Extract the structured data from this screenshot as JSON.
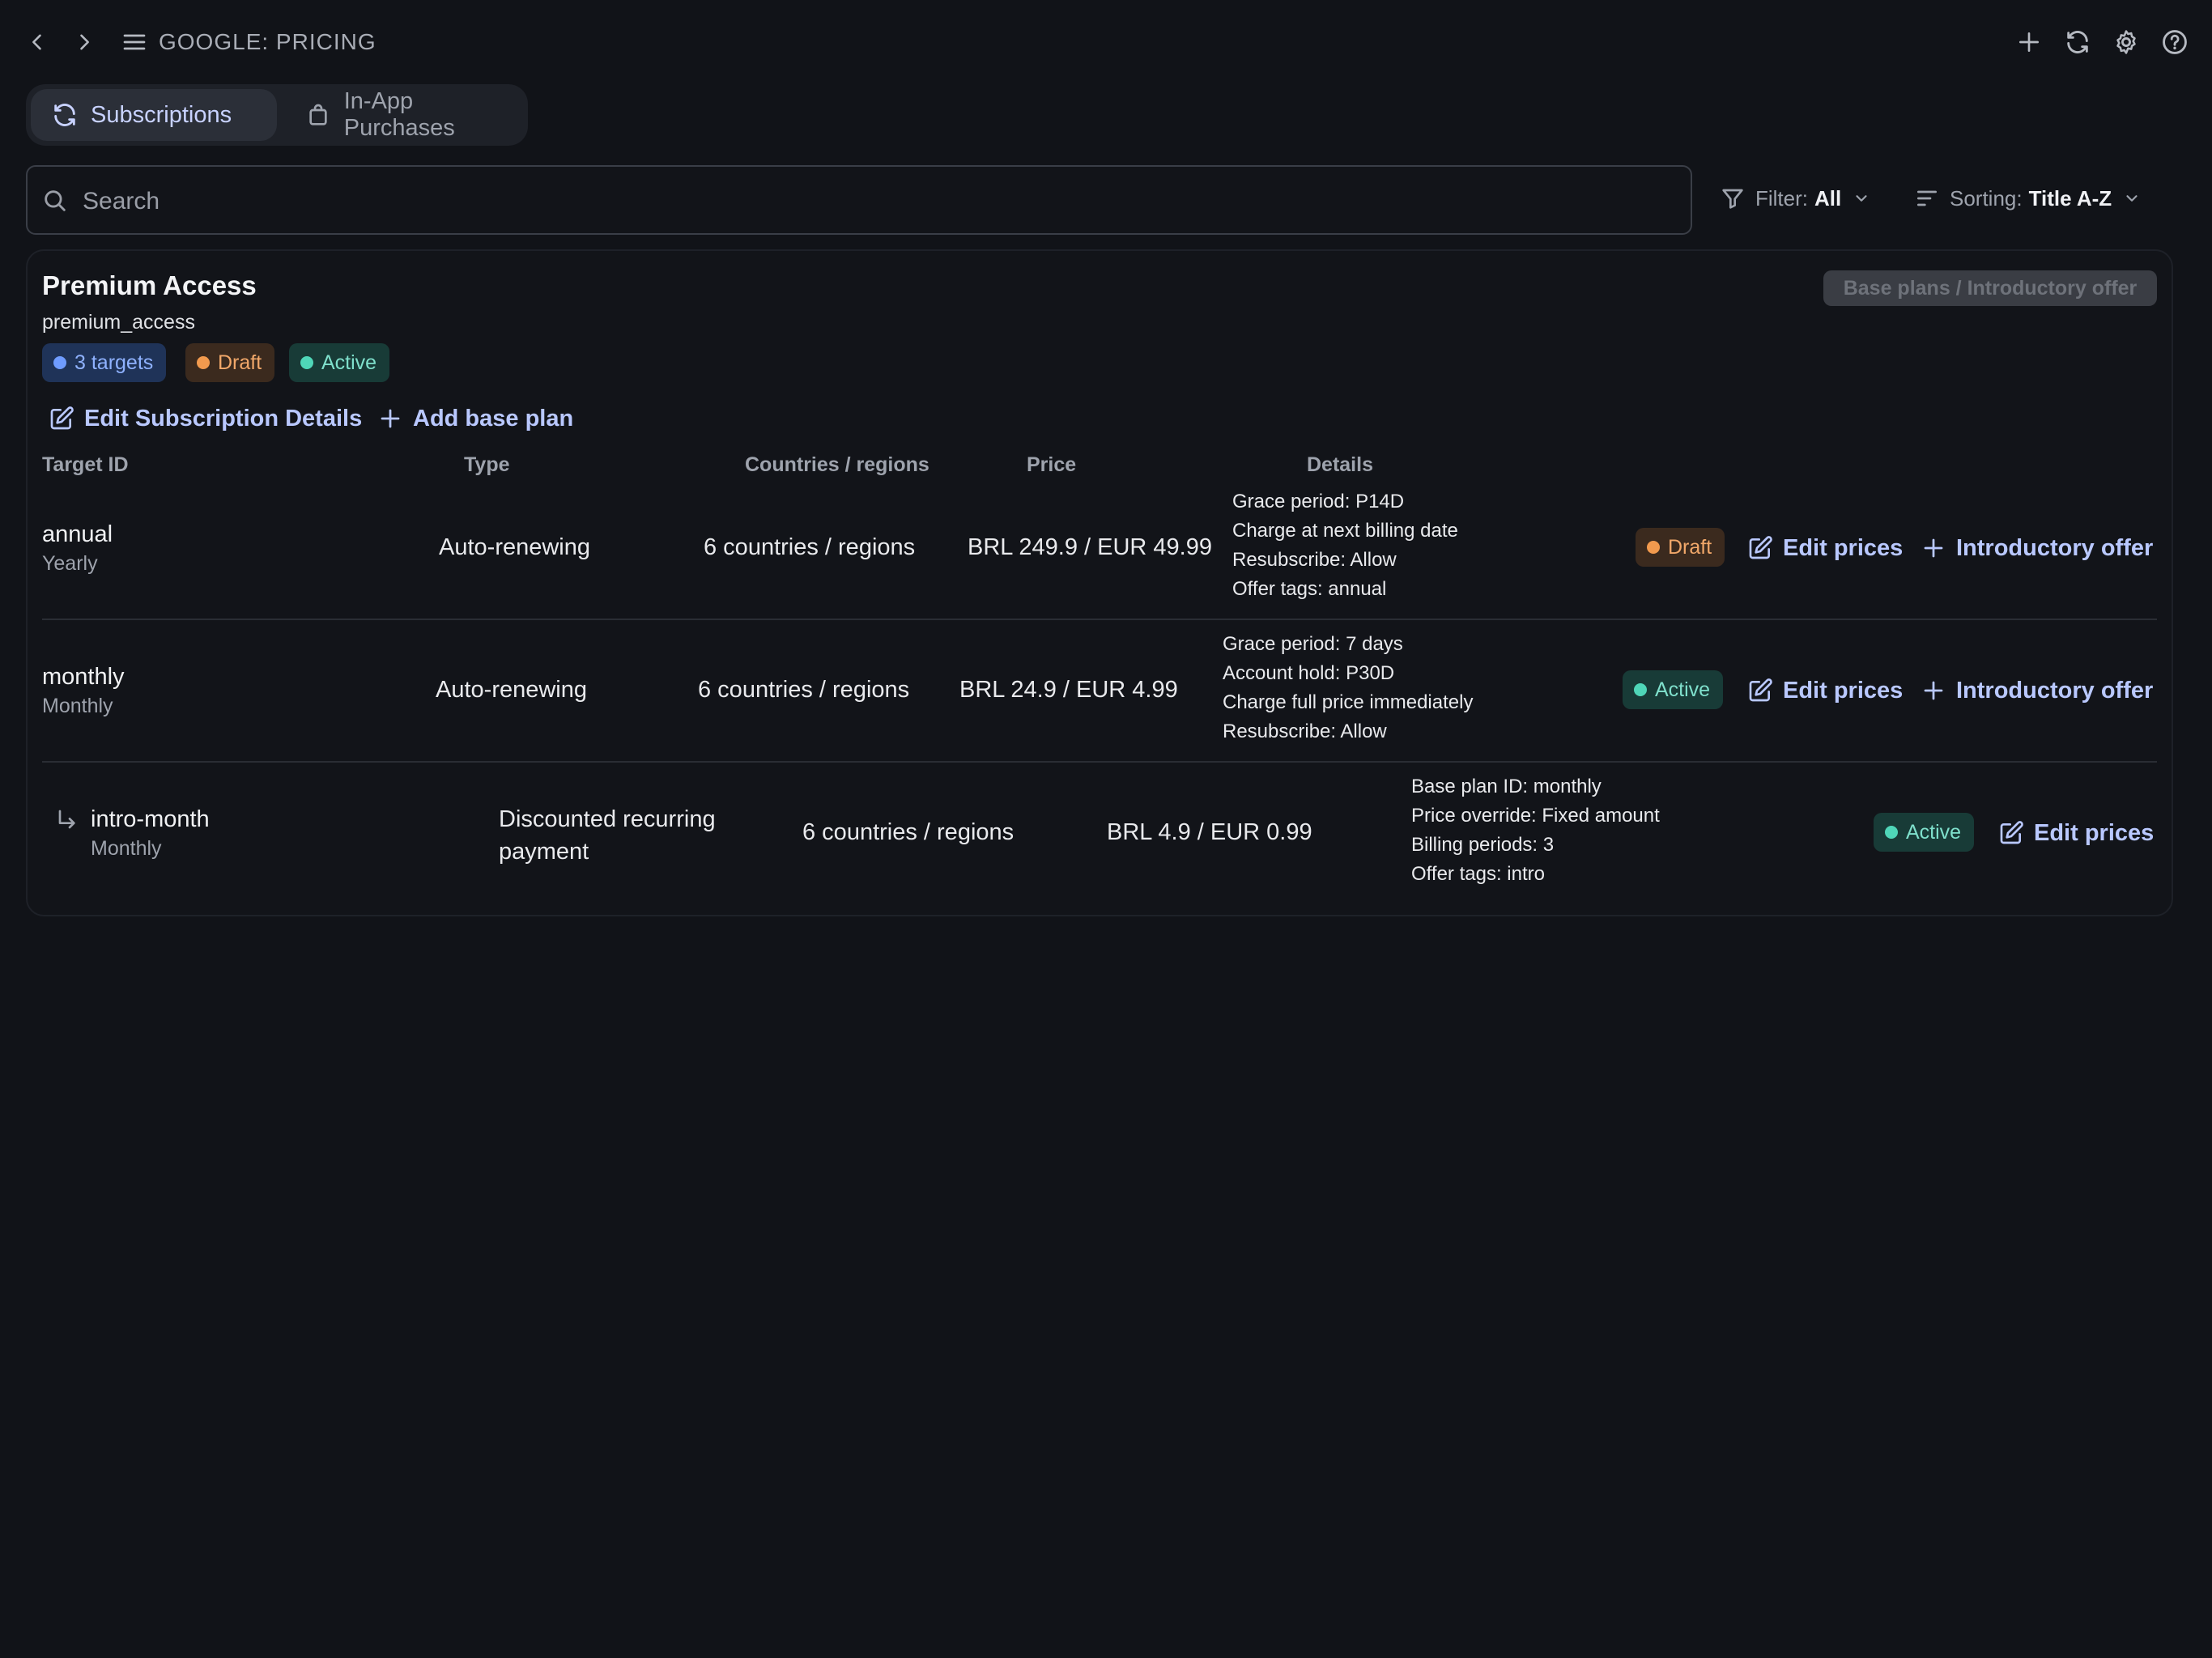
{
  "header": {
    "title": "GOOGLE: PRICING",
    "icons": [
      "back-icon",
      "forward-icon",
      "menu-icon",
      "plus-icon",
      "refresh-icon",
      "gear-icon",
      "help-icon"
    ]
  },
  "tabs": [
    {
      "label": "Subscriptions",
      "icon": "refresh-icon",
      "active": true
    },
    {
      "label": "In-App Purchases",
      "icon": "bag-icon",
      "active": false
    }
  ],
  "search": {
    "placeholder": "Search",
    "value": ""
  },
  "filter": {
    "label": "Filter:",
    "value": "All"
  },
  "sorting": {
    "label": "Sorting:",
    "value": "Title A-Z"
  },
  "subscription": {
    "title": "Premium Access",
    "id": "premium_access",
    "base_plans_button": "Base plans / Introductory offer",
    "badges": {
      "targets": "3 targets",
      "draft": "Draft",
      "active": "Active"
    },
    "actions": {
      "edit": "Edit Subscription Details",
      "add": "Add base plan"
    },
    "columns": [
      "Target ID",
      "Type",
      "Countries / regions",
      "Price",
      "Details"
    ],
    "rows": [
      {
        "id": "annual",
        "period": "Yearly",
        "type": "Auto-renewing",
        "regions": "6 countries / regions",
        "price": "BRL 249.9 / EUR 49.99",
        "details": [
          "Grace period: P14D",
          "Charge at next billing date",
          "Resubscribe: Allow",
          "Offer tags: annual"
        ],
        "status": "Draft",
        "edit": "Edit prices",
        "offer": "Introductory offer"
      },
      {
        "id": "monthly",
        "period": "Monthly",
        "type": "Auto-renewing",
        "regions": "6 countries / regions",
        "price": "BRL 24.9 / EUR 4.99",
        "details": [
          "Grace period: 7 days",
          "Account hold: P30D",
          "Charge full price immediately",
          "Resubscribe: Allow"
        ],
        "status": "Active",
        "edit": "Edit prices",
        "offer": "Introductory offer"
      },
      {
        "id": "intro-month",
        "period": "Monthly",
        "type_line1": "Discounted recurring",
        "type_line2": "payment",
        "regions": "6 countries / regions",
        "price": "BRL 4.9 / EUR 0.99",
        "details": [
          "Base plan ID: monthly",
          "Price override: Fixed amount",
          "Billing periods: 3",
          "Offer tags: intro"
        ],
        "status": "Active",
        "edit": "Edit prices"
      }
    ]
  },
  "colors": {
    "background": "#111318",
    "accent": "#b9c8ff",
    "draft": "#f29a4e",
    "active": "#4fd6b8",
    "targets": "#6f9cff"
  }
}
